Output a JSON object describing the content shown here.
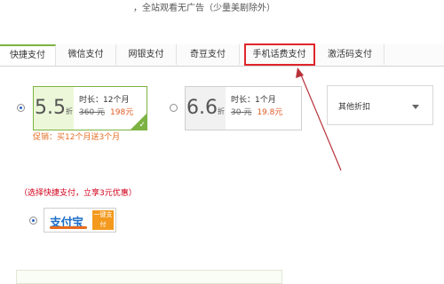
{
  "top_note": "，全站观看无广告（少量美剧除外）",
  "tabs": [
    {
      "label": "快捷支付"
    },
    {
      "label": "微信支付"
    },
    {
      "label": "网银支付"
    },
    {
      "label": "奇豆支付"
    },
    {
      "label": "手机话费支付"
    },
    {
      "label": "激活码支付"
    }
  ],
  "plans": [
    {
      "discount": "5.5",
      "discount_unit": "折",
      "duration": "时长：12个月",
      "old_price": "360 元",
      "new_price": "198元"
    },
    {
      "discount": "6.6",
      "discount_unit": "折",
      "duration": "时长：1个月",
      "old_price": "30 元",
      "new_price": "19.8元"
    }
  ],
  "other_discount": "其他折扣",
  "promo": "促销：买12个月送3个月",
  "quick_pay_hint": "（选择快捷支付，立享3元优惠）",
  "alipay": {
    "logo": "支付宝",
    "tag": "一键支付"
  },
  "colors": {
    "accent_green": "#7cb342",
    "highlight_red": "#e0252b",
    "price_orange": "#e05a24"
  },
  "icons": {
    "selected_check": "check-icon",
    "dropdown": "chevron-down-icon"
  }
}
